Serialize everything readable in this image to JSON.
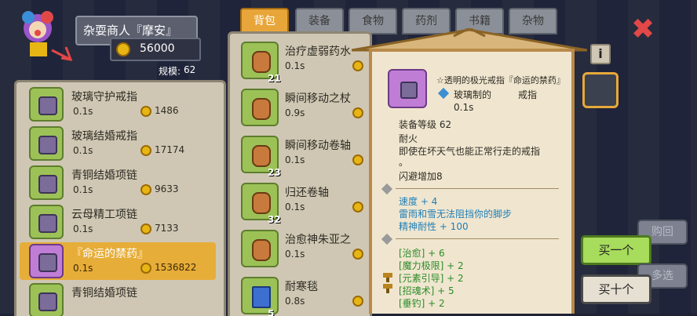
{
  "merchant": {
    "name": "杂耍商人『摩安』",
    "gold": "56000",
    "scale_label": "规模:",
    "scale_value": "62"
  },
  "tabs": [
    {
      "label": "背包",
      "active": true
    },
    {
      "label": "装备",
      "active": false
    },
    {
      "label": "食物",
      "active": false
    },
    {
      "label": "药剂",
      "active": false
    },
    {
      "label": "书籍",
      "active": false
    },
    {
      "label": "杂物",
      "active": false
    }
  ],
  "shop_list": [
    {
      "name": "玻璃守护戒指",
      "time": "0.1s",
      "price": "1486"
    },
    {
      "name": "玻璃结婚戒指",
      "time": "0.1s",
      "price": "17174"
    },
    {
      "name": "青铜结婚项链",
      "time": "0.1s",
      "price": "9633"
    },
    {
      "name": "云母精工项链",
      "time": "0.1s",
      "price": "7133"
    },
    {
      "name": "『命运的禁药』",
      "time": "0.1s",
      "price": "1536822",
      "selected": true
    },
    {
      "name": "青铜结婚项链",
      "time": "",
      "price": ""
    }
  ],
  "bag_list": [
    {
      "name": "治疗虚弱药水",
      "time": "0.1s",
      "qty": "21"
    },
    {
      "name": "瞬间移动之杖",
      "time": "0.9s",
      "qty": ""
    },
    {
      "name": "瞬间移动卷轴",
      "time": "0.1s",
      "qty": "23"
    },
    {
      "name": "归还卷轴",
      "time": "0.1s",
      "qty": "32"
    },
    {
      "name": "治愈神朱亚之",
      "time": "0.1s",
      "qty": ""
    },
    {
      "name": "耐寒毯",
      "time": "0.8s",
      "qty": "5"
    }
  ],
  "detail": {
    "title": "☆透明的极光戒指『命运的禁药』",
    "material": "玻璃制的",
    "type": "戒指",
    "time": "0.1s",
    "level": "装备等级 62",
    "fire": "耐火",
    "desc1": "即使在坏天气也能正常行走的戒指",
    "desc2": "。",
    "evade": "闪避增加8",
    "blue_lines": [
      "速度 + 4",
      "雷雨和雪无法阻挡你的脚步",
      "精神耐性 + 100"
    ],
    "green_lines": [
      "[治愈] + 6",
      "[魔力极限] + 2",
      "[元素引导] + 2",
      "[招魂术] + 5",
      "[垂钓] + 2"
    ]
  },
  "buttons": {
    "buy_one": "买一个",
    "buy_ten": "买十个",
    "repurchase": "购回",
    "multi_select": "多选",
    "info": "i"
  },
  "colors": {
    "accent": "#e8a63a",
    "buy_green": "#a7dc5c",
    "close_red": "#e24848"
  }
}
